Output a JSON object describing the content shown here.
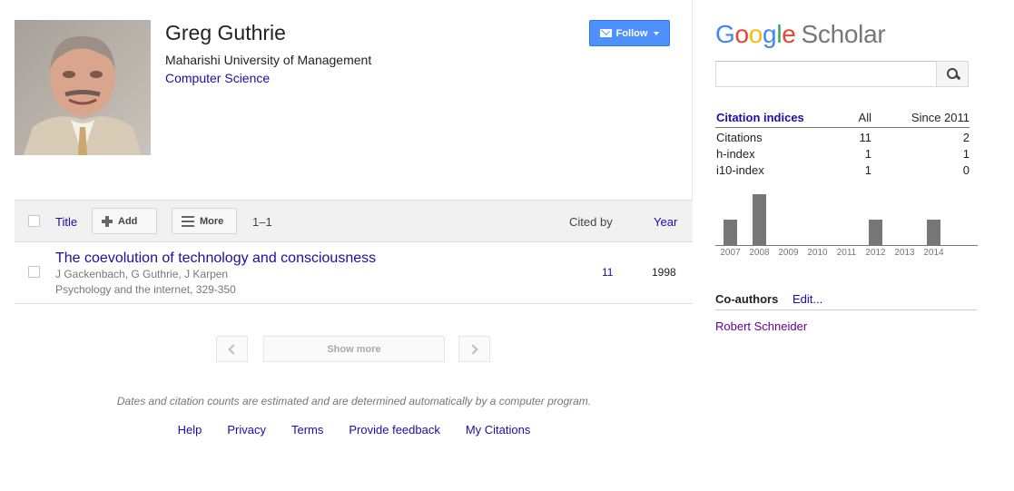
{
  "profile": {
    "name": "Greg Guthrie",
    "affiliation": "Maharishi University of Management",
    "field": "Computer Science",
    "follow_label": "Follow"
  },
  "table": {
    "header": {
      "title_label": "Title",
      "add_label": "Add",
      "more_label": "More",
      "range": "1–1",
      "cited_by_label": "Cited by",
      "year_label": "Year"
    },
    "articles": [
      {
        "title": "The coevolution of technology and consciousness",
        "authors": "J Gackenbach, G Guthrie, J Karpen",
        "venue": "Psychology and the internet, 329-350",
        "cited_by": "11",
        "year": "1998"
      }
    ],
    "show_more_label": "Show more"
  },
  "footer": {
    "disclaimer": "Dates and citation counts are estimated and are determined automatically by a computer program.",
    "links": [
      "Help",
      "Privacy",
      "Terms",
      "Provide feedback",
      "My Citations"
    ]
  },
  "sidebar": {
    "logo_google": "Google",
    "logo_scholar": "Scholar",
    "search": {
      "value": "",
      "placeholder": ""
    },
    "citation_indices": {
      "label": "Citation indices",
      "col_all": "All",
      "col_since": "Since 2011",
      "rows": [
        {
          "label": "Citations",
          "all": "11",
          "since": "2"
        },
        {
          "label": "h-index",
          "all": "1",
          "since": "1"
        },
        {
          "label": "i10-index",
          "all": "1",
          "since": "0"
        }
      ]
    },
    "coauthors": {
      "label": "Co-authors",
      "edit_label": "Edit...",
      "names": [
        "Robert Schneider"
      ]
    }
  },
  "chart_data": {
    "type": "bar",
    "categories": [
      "2007",
      "2008",
      "2009",
      "2010",
      "2011",
      "2012",
      "2013",
      "2014"
    ],
    "values": [
      1,
      2,
      0,
      0,
      0,
      1,
      0,
      1
    ],
    "bar_color": "#777777",
    "ylim": [
      0,
      2
    ]
  }
}
